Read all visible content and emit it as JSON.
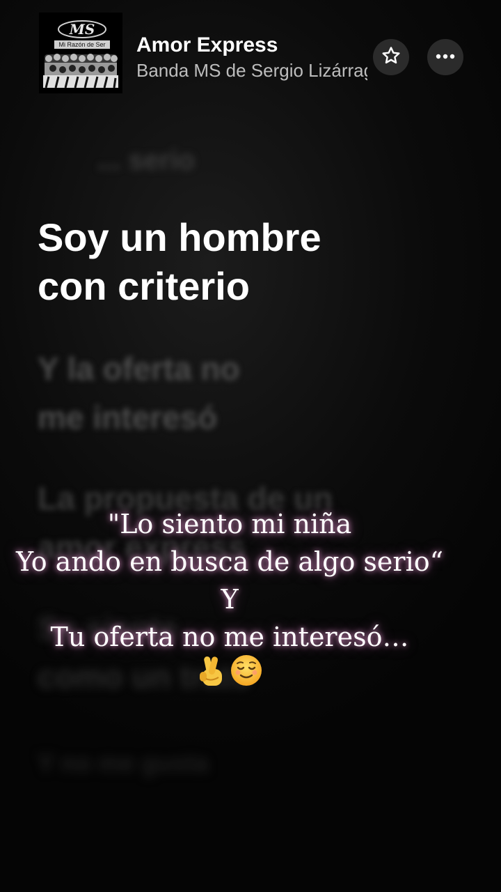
{
  "song": {
    "title": "Amor Express",
    "artist": "Banda MS de Sergio Lizárraga"
  },
  "album_art": {
    "logo_text": "MS",
    "caption": "Mi Razón de Ser"
  },
  "header": {
    "star_icon": "star-icon",
    "more_icon": "more-icon"
  },
  "lyrics": {
    "previous": "... serio",
    "current": "Soy un hombre\ncon criterio",
    "upcoming": [
      "Y la oferta no\nme interesó",
      "La propuesta de un\namor express",
      "Se siente\ncomo un trato",
      "Y no me gusta"
    ]
  },
  "overlay_text": {
    "lines": [
      "\"Lo siento mi niña",
      "Yo ando en busca de algo serio“",
      "Y",
      "Tu oferta no me interesó…"
    ],
    "emojis": [
      "crossed-fingers-emoji",
      "relieved-face-emoji"
    ]
  },
  "colors": {
    "background": "#050505",
    "current_lyric": "#ffffff",
    "glow": "#f0a0dc"
  }
}
